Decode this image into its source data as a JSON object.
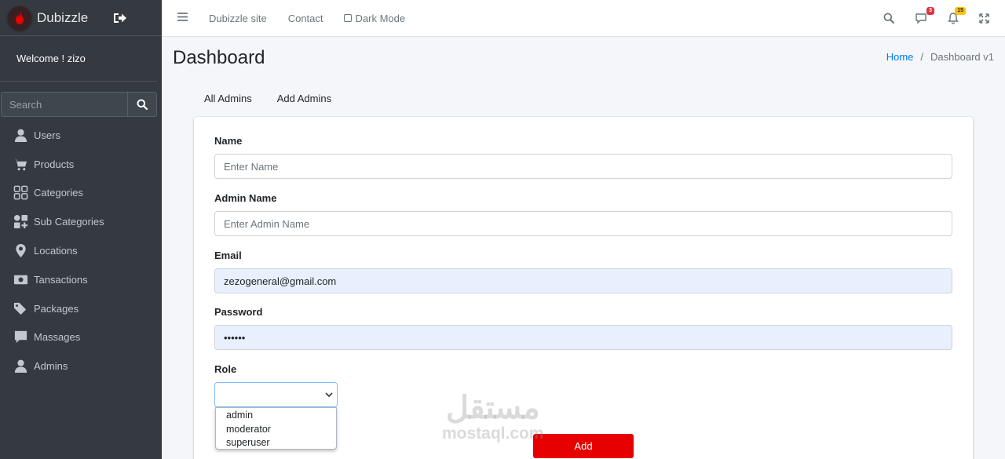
{
  "brand": {
    "name": "Dubizzle",
    "accent": "#e60000"
  },
  "sidebar": {
    "welcome": "Welcome ! zizo",
    "search_placeholder": "Search",
    "items": [
      {
        "label": "Users",
        "icon": "user-icon"
      },
      {
        "label": "Products",
        "icon": "cart-icon"
      },
      {
        "label": "Categories",
        "icon": "grid-icon"
      },
      {
        "label": "Sub Categories",
        "icon": "shapes-icon"
      },
      {
        "label": "Locations",
        "icon": "map-marker-icon"
      },
      {
        "label": "Tansactions",
        "icon": "money-icon"
      },
      {
        "label": "Packages",
        "icon": "tags-icon"
      },
      {
        "label": "Massages",
        "icon": "comment-icon"
      },
      {
        "label": "Admins",
        "icon": "user-icon"
      }
    ]
  },
  "topnav": {
    "links": [
      "Dubizzle site",
      "Contact"
    ],
    "dark_mode_label": "Dark Mode",
    "messages_badge": "3",
    "notifications_badge": "15"
  },
  "header": {
    "title": "Dashboard",
    "breadcrumb_home": "Home",
    "breadcrumb_separator": "/",
    "breadcrumb_current": "Dashboard v1"
  },
  "tabs": [
    "All Admins",
    "Add Admins"
  ],
  "form": {
    "name_label": "Name",
    "name_placeholder": "Enter Name",
    "admin_name_label": "Admin Name",
    "admin_name_placeholder": "Enter Admin Name",
    "email_label": "Email",
    "email_value": "zezogeneral@gmail.com",
    "password_label": "Password",
    "password_value": "••••••",
    "role_label": "Role",
    "role_options": [
      "admin",
      "moderator",
      "superuser"
    ],
    "submit_label": "Add"
  },
  "watermark": {
    "arabic": "مستقل",
    "latin": "mostaql.com"
  }
}
